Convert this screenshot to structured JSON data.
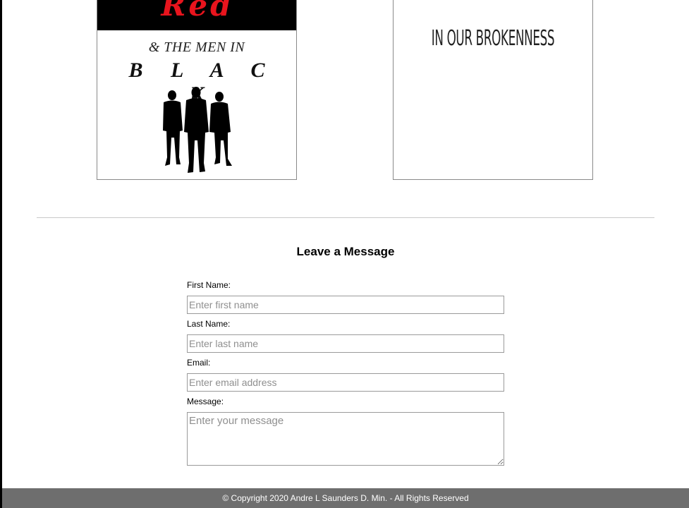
{
  "books": [
    {
      "cover_title_word1": "Red",
      "cover_title_line2": "& THE MEN IN",
      "cover_title_word3": "B L A C K",
      "cover_image_icon": "three-men-silhouette"
    },
    {
      "cover_title": "IN OUR BROKENNESS"
    }
  ],
  "contact_form": {
    "title": "Leave a Message",
    "first_name": {
      "label": "First Name:",
      "placeholder": "Enter first name",
      "value": ""
    },
    "last_name": {
      "label": "Last Name:",
      "placeholder": "Enter last name",
      "value": ""
    },
    "email": {
      "label": "Email:",
      "placeholder": "Enter email address",
      "value": ""
    },
    "message": {
      "label": "Message:",
      "placeholder": "Enter your message",
      "value": ""
    }
  },
  "footer": {
    "copyright": "© Copyright 2020 Andre L Saunders D. Min. - All Rights Reserved"
  },
  "colors": {
    "footer_bg": "#6e6e6e",
    "cover_red": "#e8141d",
    "cover_band": "#000000"
  }
}
